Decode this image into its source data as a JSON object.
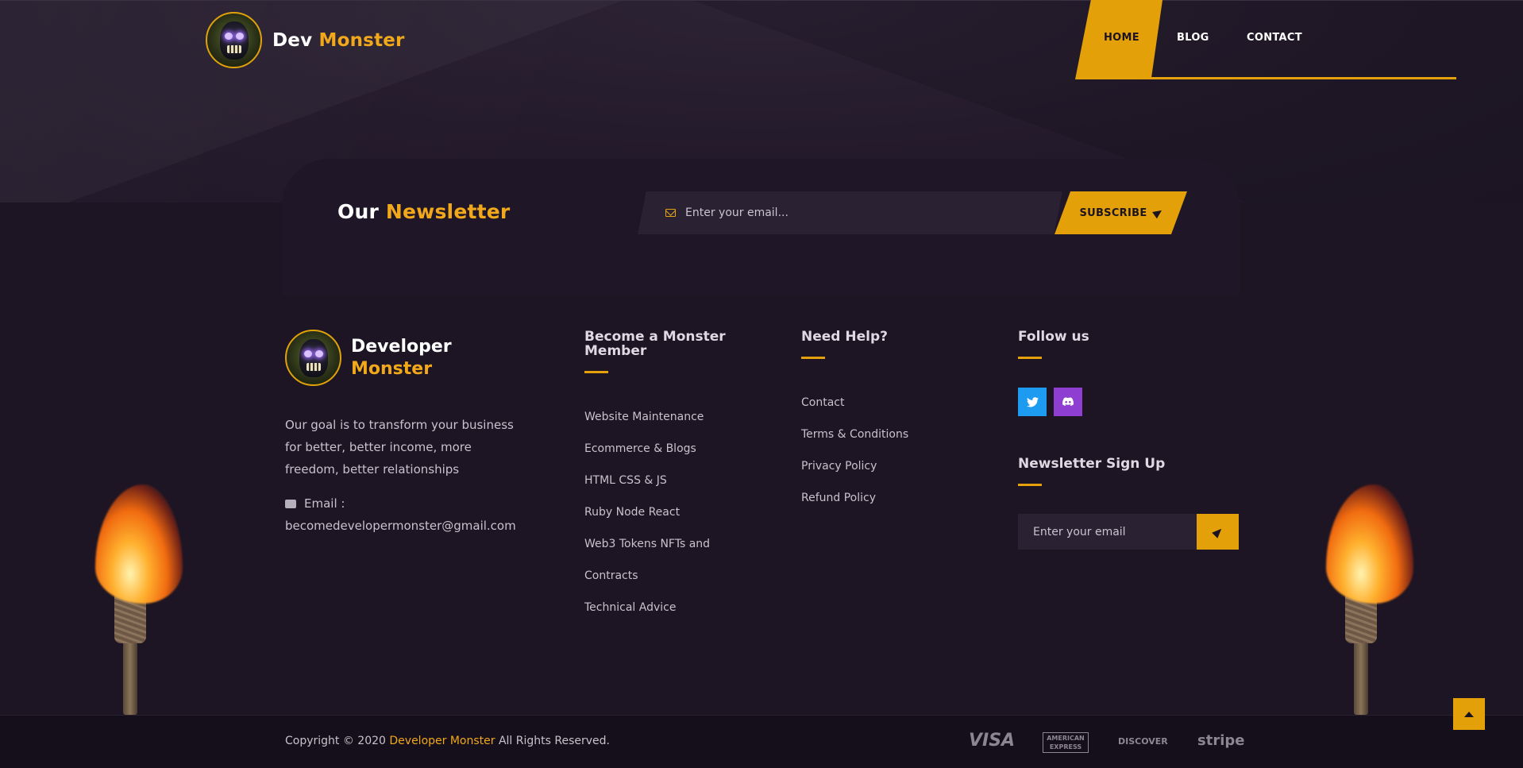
{
  "header": {
    "brand_first": "Dev",
    "brand_second": "Monster",
    "nav": [
      "HOME",
      "BLOG",
      "CONTACT"
    ],
    "active_nav": "HOME"
  },
  "newsletter": {
    "title_first": "Our",
    "title_second": "Newsletter",
    "placeholder": "Enter your email...",
    "button_label": "SUBSCRIBE"
  },
  "footer": {
    "brand_first": "Developer",
    "brand_second": "Monster",
    "about": "Our goal is to transform your business for better, better income, more freedom, better relationships",
    "email_label": "Email :",
    "email": "becomedevelopermonster@gmail.com",
    "columns": [
      {
        "title": "Become a Monster Member",
        "links": [
          "Website Maintenance",
          "Ecommerce & Blogs",
          "HTML CSS & JS",
          "Ruby Node React",
          "Web3 Tokens NFTs and",
          "Contracts",
          "Technical Advice"
        ]
      },
      {
        "title": "Need Help?",
        "links": [
          "Contact",
          "Terms & Conditions",
          "Privacy Policy",
          "Refund Policy"
        ]
      }
    ],
    "follow_title": "Follow us",
    "social_icons": [
      "twitter-icon",
      "discord-icon"
    ],
    "signup_title": "Newsletter Sign Up",
    "signup_placeholder": "Enter your email"
  },
  "bottom": {
    "copyright_prefix": "Copyright © 2020",
    "copyright_brand": "Developer Monster",
    "copyright_suffix": "All Rights Reserved.",
    "payments": [
      "VISA",
      "AMERICAN EXPRESS",
      "DISCOVER",
      "stripe"
    ]
  },
  "colors": {
    "accent": "#e3a008",
    "background": "#1d1524",
    "twitter": "#1d9bf0",
    "discord": "#8e3fd1"
  }
}
